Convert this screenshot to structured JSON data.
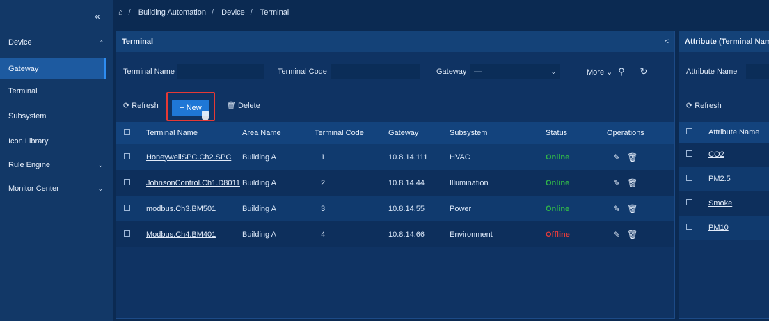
{
  "breadcrumb": [
    "Building Automation",
    "Device",
    "Terminal"
  ],
  "sidebar": {
    "collapse_glyph": "«",
    "items": [
      {
        "label": "Device",
        "chev": "^"
      },
      {
        "label": "Gateway"
      },
      {
        "label": "Terminal"
      },
      {
        "label": "Subsystem"
      },
      {
        "label": "Icon Library"
      },
      {
        "label": "Rule Engine",
        "chev": "⌄"
      },
      {
        "label": "Monitor Center",
        "chev": "⌄"
      }
    ]
  },
  "terminal_panel": {
    "title": "Terminal",
    "filters": {
      "terminal_name_label": "Terminal Name",
      "terminal_code_label": "Terminal Code",
      "gateway_label": "Gateway",
      "gateway_value": "—",
      "more_label": "More"
    },
    "toolbar": {
      "refresh": "Refresh",
      "new": "New",
      "delete": "Delete"
    },
    "columns": [
      "Terminal Name",
      "Area Name",
      "Terminal Code",
      "Gateway",
      "Subsystem",
      "Status",
      "Operations"
    ],
    "rows": [
      {
        "name": "HoneywellSPC.Ch2.SPC",
        "area": "Building A",
        "code": "1",
        "gateway": "10.8.14.111",
        "subsystem": "HVAC",
        "status": "Online"
      },
      {
        "name": "JohnsonControl.Ch1.D8011",
        "area": "Building A",
        "code": "2",
        "gateway": "10.8.14.44",
        "subsystem": "Illumination",
        "status": "Online"
      },
      {
        "name": "modbus.Ch3.BM501",
        "area": "Building A",
        "code": "3",
        "gateway": "10.8.14.55",
        "subsystem": "Power",
        "status": "Online"
      },
      {
        "name": "Modbus.Ch4.BM401",
        "area": "Building A",
        "code": "4",
        "gateway": "10.8.14.66",
        "subsystem": "Environment",
        "status": "Offline"
      }
    ]
  },
  "attribute_panel": {
    "title": "Attribute (Terminal Nam",
    "filter_label": "Attribute Name",
    "refresh": "Refresh",
    "column": "Attribute Name",
    "rows": [
      "CO2",
      "PM2.5",
      "Smoke",
      "PM10"
    ]
  },
  "colors": {
    "online": "#2fb34a",
    "offline": "#e23b3b",
    "accent": "#1f77d6"
  }
}
